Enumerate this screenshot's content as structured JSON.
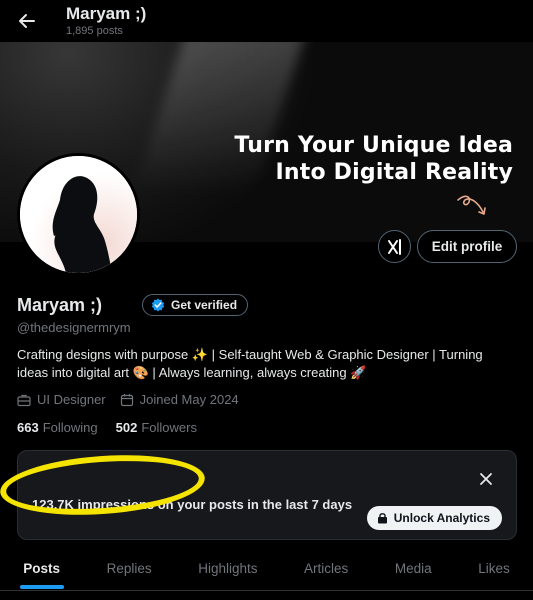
{
  "header": {
    "title": "Maryam ;)",
    "post_count": "1,895 posts"
  },
  "banner": {
    "line1": "Turn Your Unique Idea",
    "line2": "Into Digital Reality"
  },
  "actions": {
    "x_label": "X",
    "edit_profile": "Edit profile"
  },
  "profile": {
    "name": "Maryam ;)",
    "get_verified": "Get verified",
    "handle": "@thedesignermrym",
    "bio": "Crafting designs with purpose ✨ | Self-taught Web & Graphic Designer | Turning ideas into digital art 🎨 | Always learning, always creating 🚀",
    "profession": "UI Designer",
    "joined": "Joined May 2024",
    "following_count": "663",
    "following_label": "Following",
    "followers_count": "502",
    "followers_label": "Followers"
  },
  "analytics": {
    "message": "123.7K impressions on your posts in the last 7 days",
    "unlock_label": "Unlock Analytics"
  },
  "tabs": [
    {
      "label": "Posts",
      "active": true
    },
    {
      "label": "Replies"
    },
    {
      "label": "Highlights"
    },
    {
      "label": "Articles"
    },
    {
      "label": "Media"
    },
    {
      "label": "Likes"
    }
  ],
  "colors": {
    "accent": "#1d9bf0",
    "annotation": "#f5e400",
    "background": "#000000"
  }
}
